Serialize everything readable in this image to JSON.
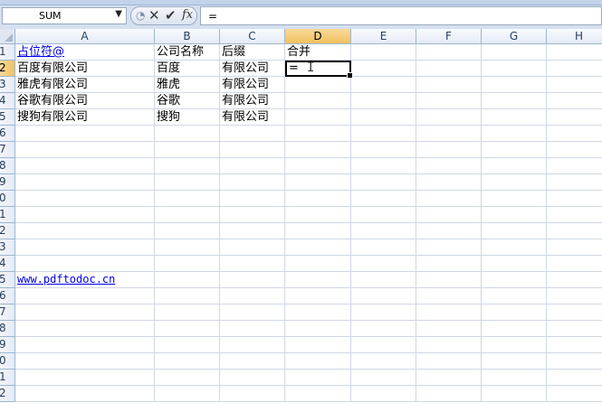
{
  "formula_bar": {
    "name_box": "SUM",
    "formula": "="
  },
  "columns": [
    "A",
    "B",
    "C",
    "D",
    "E",
    "F",
    "G",
    "H"
  ],
  "selected_column": "D",
  "selected_row": "2",
  "rows": [
    "1",
    "2",
    "3",
    "4",
    "5",
    "6",
    "7",
    "8",
    "9",
    "0",
    "1",
    "2",
    "3",
    "4",
    "5",
    "6",
    "7",
    "8",
    "9",
    "0",
    "1",
    "2"
  ],
  "cells": {
    "A1": "占位符@",
    "B1": "公司名称",
    "C1": "后缀",
    "D1": "合并",
    "A2": "百度有限公司",
    "B2": "百度",
    "C2": "有限公司",
    "D2": "=",
    "A3": "雅虎有限公司",
    "B3": "雅虎",
    "C3": "有限公司",
    "A4": "谷歌有限公司",
    "B4": "谷歌",
    "C4": "有限公司",
    "A5": "搜狗有限公司",
    "B5": "搜狗",
    "C5": "有限公司",
    "A15": "www.pdftodoc.cn"
  }
}
